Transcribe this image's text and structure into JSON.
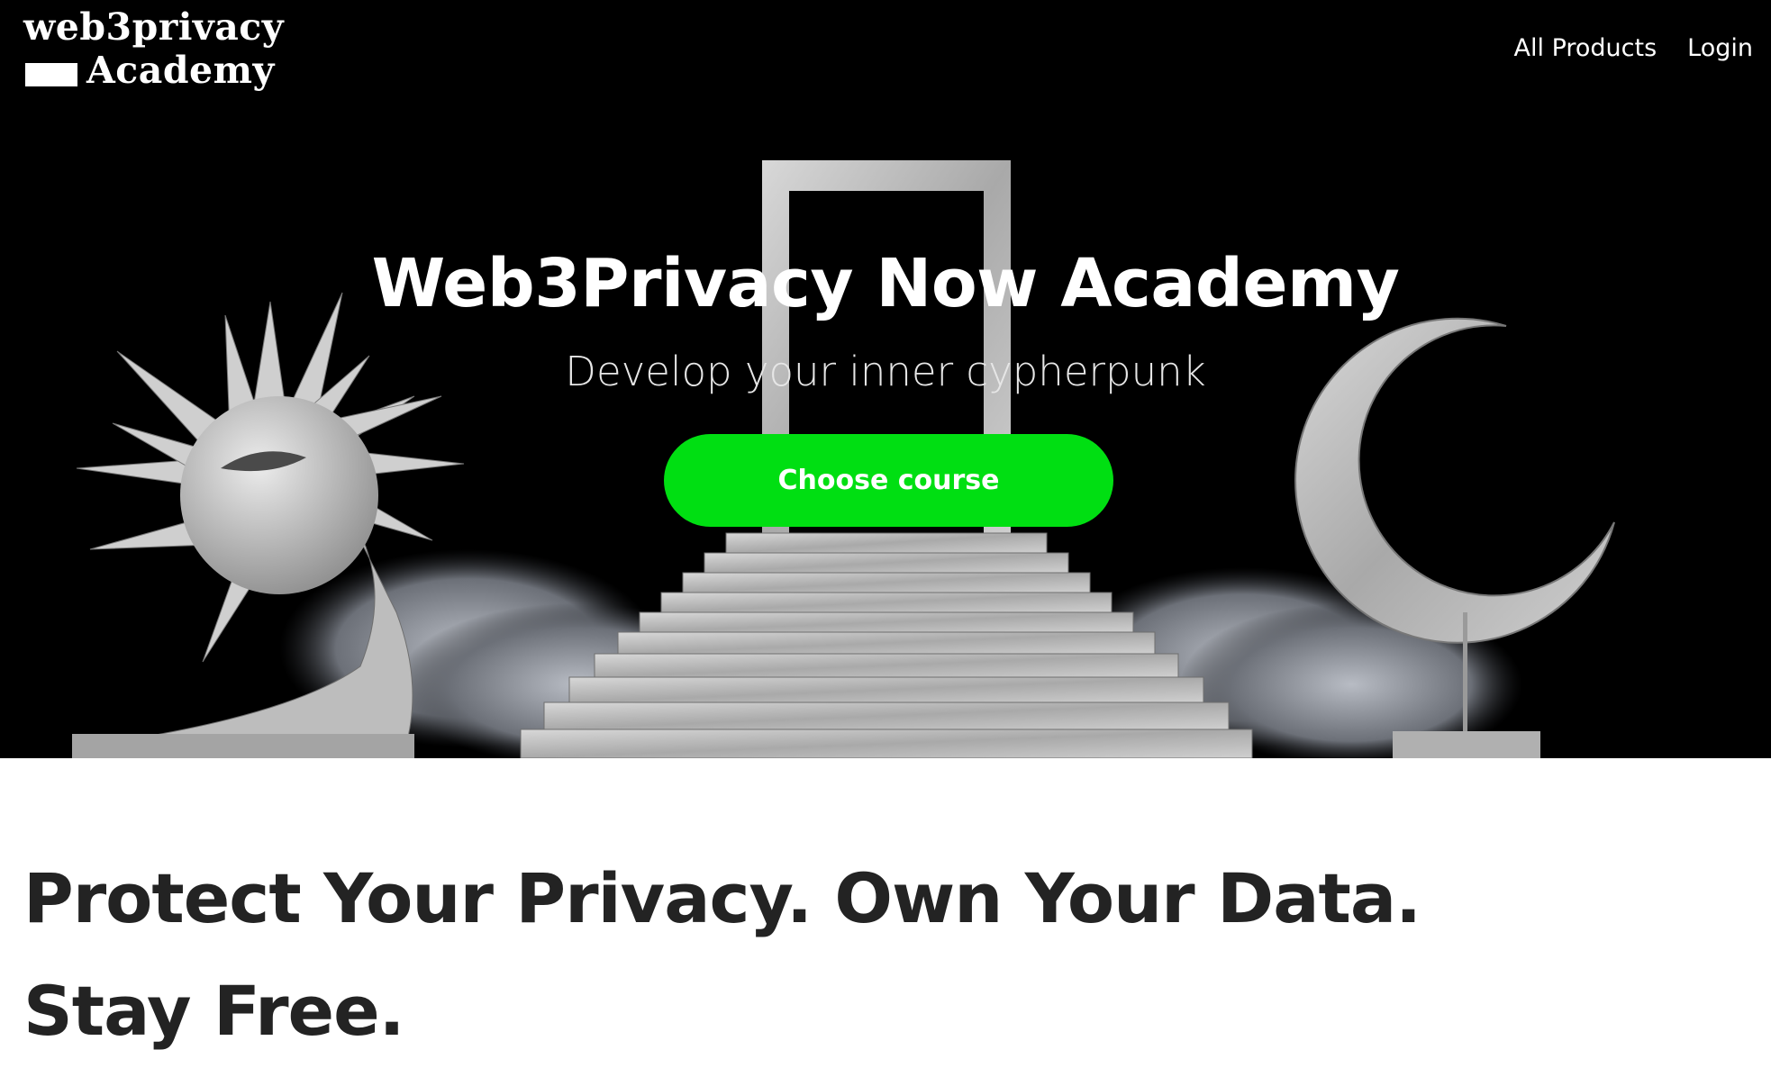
{
  "header": {
    "logo_line1": "web3privacy",
    "logo_line2": "Academy",
    "nav": [
      "All Products",
      "Login"
    ]
  },
  "hero": {
    "title": "Web3Privacy Now Academy",
    "subtitle": "Develop your inner cypherpunk",
    "cta_label": "Choose course",
    "cta_color": "#00df12",
    "background_color": "#000000"
  },
  "main": {
    "headline_line1": "Protect Your Privacy. Own Your Data.",
    "headline_line2": "Stay Free."
  }
}
